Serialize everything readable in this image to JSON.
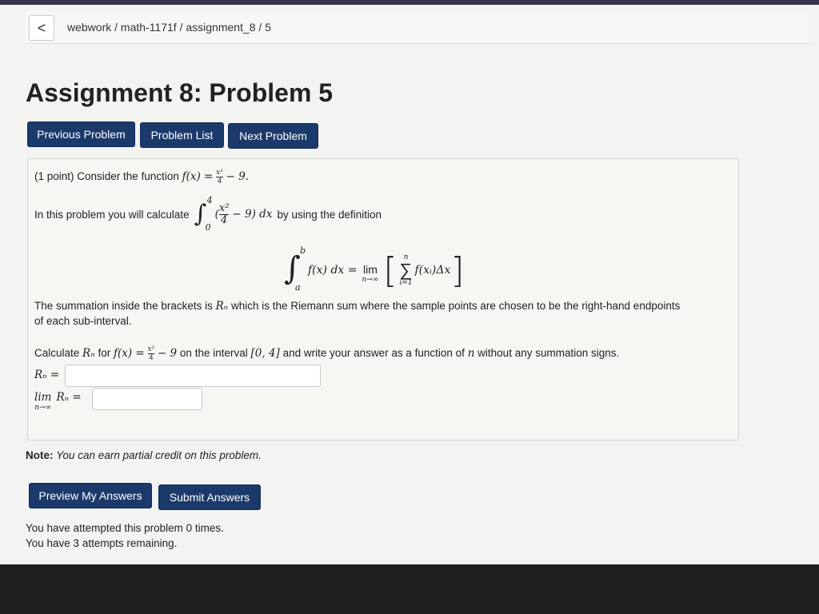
{
  "breadcrumb": {
    "back_label": "<",
    "path": "webwork / math-1171f / assignment_8 / 5"
  },
  "page_title": "Assignment 8: Problem 5",
  "nav": {
    "previous": "Previous Problem",
    "list": "Problem List",
    "next": "Next Problem"
  },
  "problem": {
    "intro": "(1 point) Consider the function",
    "function_lhs": "f(x) =",
    "function_num": "x²",
    "function_den": "4",
    "function_rest": "− 9.",
    "calc_prefix": "In this problem you will calculate",
    "integral_upper": "4",
    "integral_lower": "0",
    "integrand_open": "(",
    "integrand_num": "x²",
    "integrand_den": "4",
    "integrand_rest": "− 9) dx",
    "calc_suffix": "by using the definition",
    "def_upper": "b",
    "def_lower": "a",
    "def_integrand": "f(x) dx =",
    "def_lim": "lim",
    "def_lim_sub": "n→∞",
    "def_sum_upper": "n",
    "def_sum_lower": "i=1",
    "def_sum_body": "f(xᵢ)Δx",
    "summation_line1_a": "The summation inside the brackets is",
    "summation_Rn": "Rₙ",
    "summation_line1_b": "which is the Riemann sum where the sample points are chosen to be the right-hand endpoints",
    "summation_line2": "of each sub-interval.",
    "calculate_a": "Calculate",
    "calculate_Rn": "Rₙ",
    "calculate_b": "for",
    "calculate_fx": "f(x) =",
    "calculate_num": "x²",
    "calculate_den": "4",
    "calculate_c": "− 9",
    "calculate_d": "on the interval",
    "calculate_interval": "[0, 4]",
    "calculate_e": "and write your answer as a function of",
    "calculate_n": "n",
    "calculate_f": "without any summation signs.",
    "answer1_label": "Rₙ =",
    "answer1_value": "",
    "answer2_lim": "lim",
    "answer2_sub": "n→∞",
    "answer2_label": "Rₙ =",
    "answer2_value": ""
  },
  "note": {
    "label": "Note:",
    "text": "You can earn partial credit on this problem."
  },
  "actions": {
    "preview": "Preview My Answers",
    "submit": "Submit Answers"
  },
  "status": {
    "attempted": "You have attempted this problem 0 times.",
    "remaining": "You have 3 attempts remaining."
  },
  "colors": {
    "button_bg": "#1b3a6b",
    "page_bg": "#f3f4f2"
  }
}
